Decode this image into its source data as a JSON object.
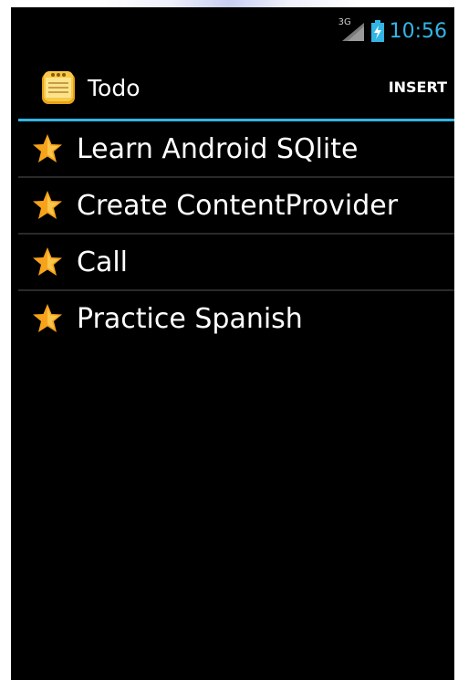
{
  "status_bar": {
    "network_label": "3G",
    "time": "10:56",
    "clock_color": "#33b5e5",
    "icons": [
      "signal-icon",
      "battery-charging-icon"
    ]
  },
  "action_bar": {
    "title": "Todo",
    "insert_label": "INSERT",
    "accent_color": "#33b5e5",
    "app_icon": "notepad-icon"
  },
  "todo_list": {
    "item_icon": "star-icon",
    "items": [
      {
        "label": "Learn Android SQlite"
      },
      {
        "label": "Create ContentProvider"
      },
      {
        "label": "Call"
      },
      {
        "label": "Practice Spanish"
      }
    ]
  }
}
